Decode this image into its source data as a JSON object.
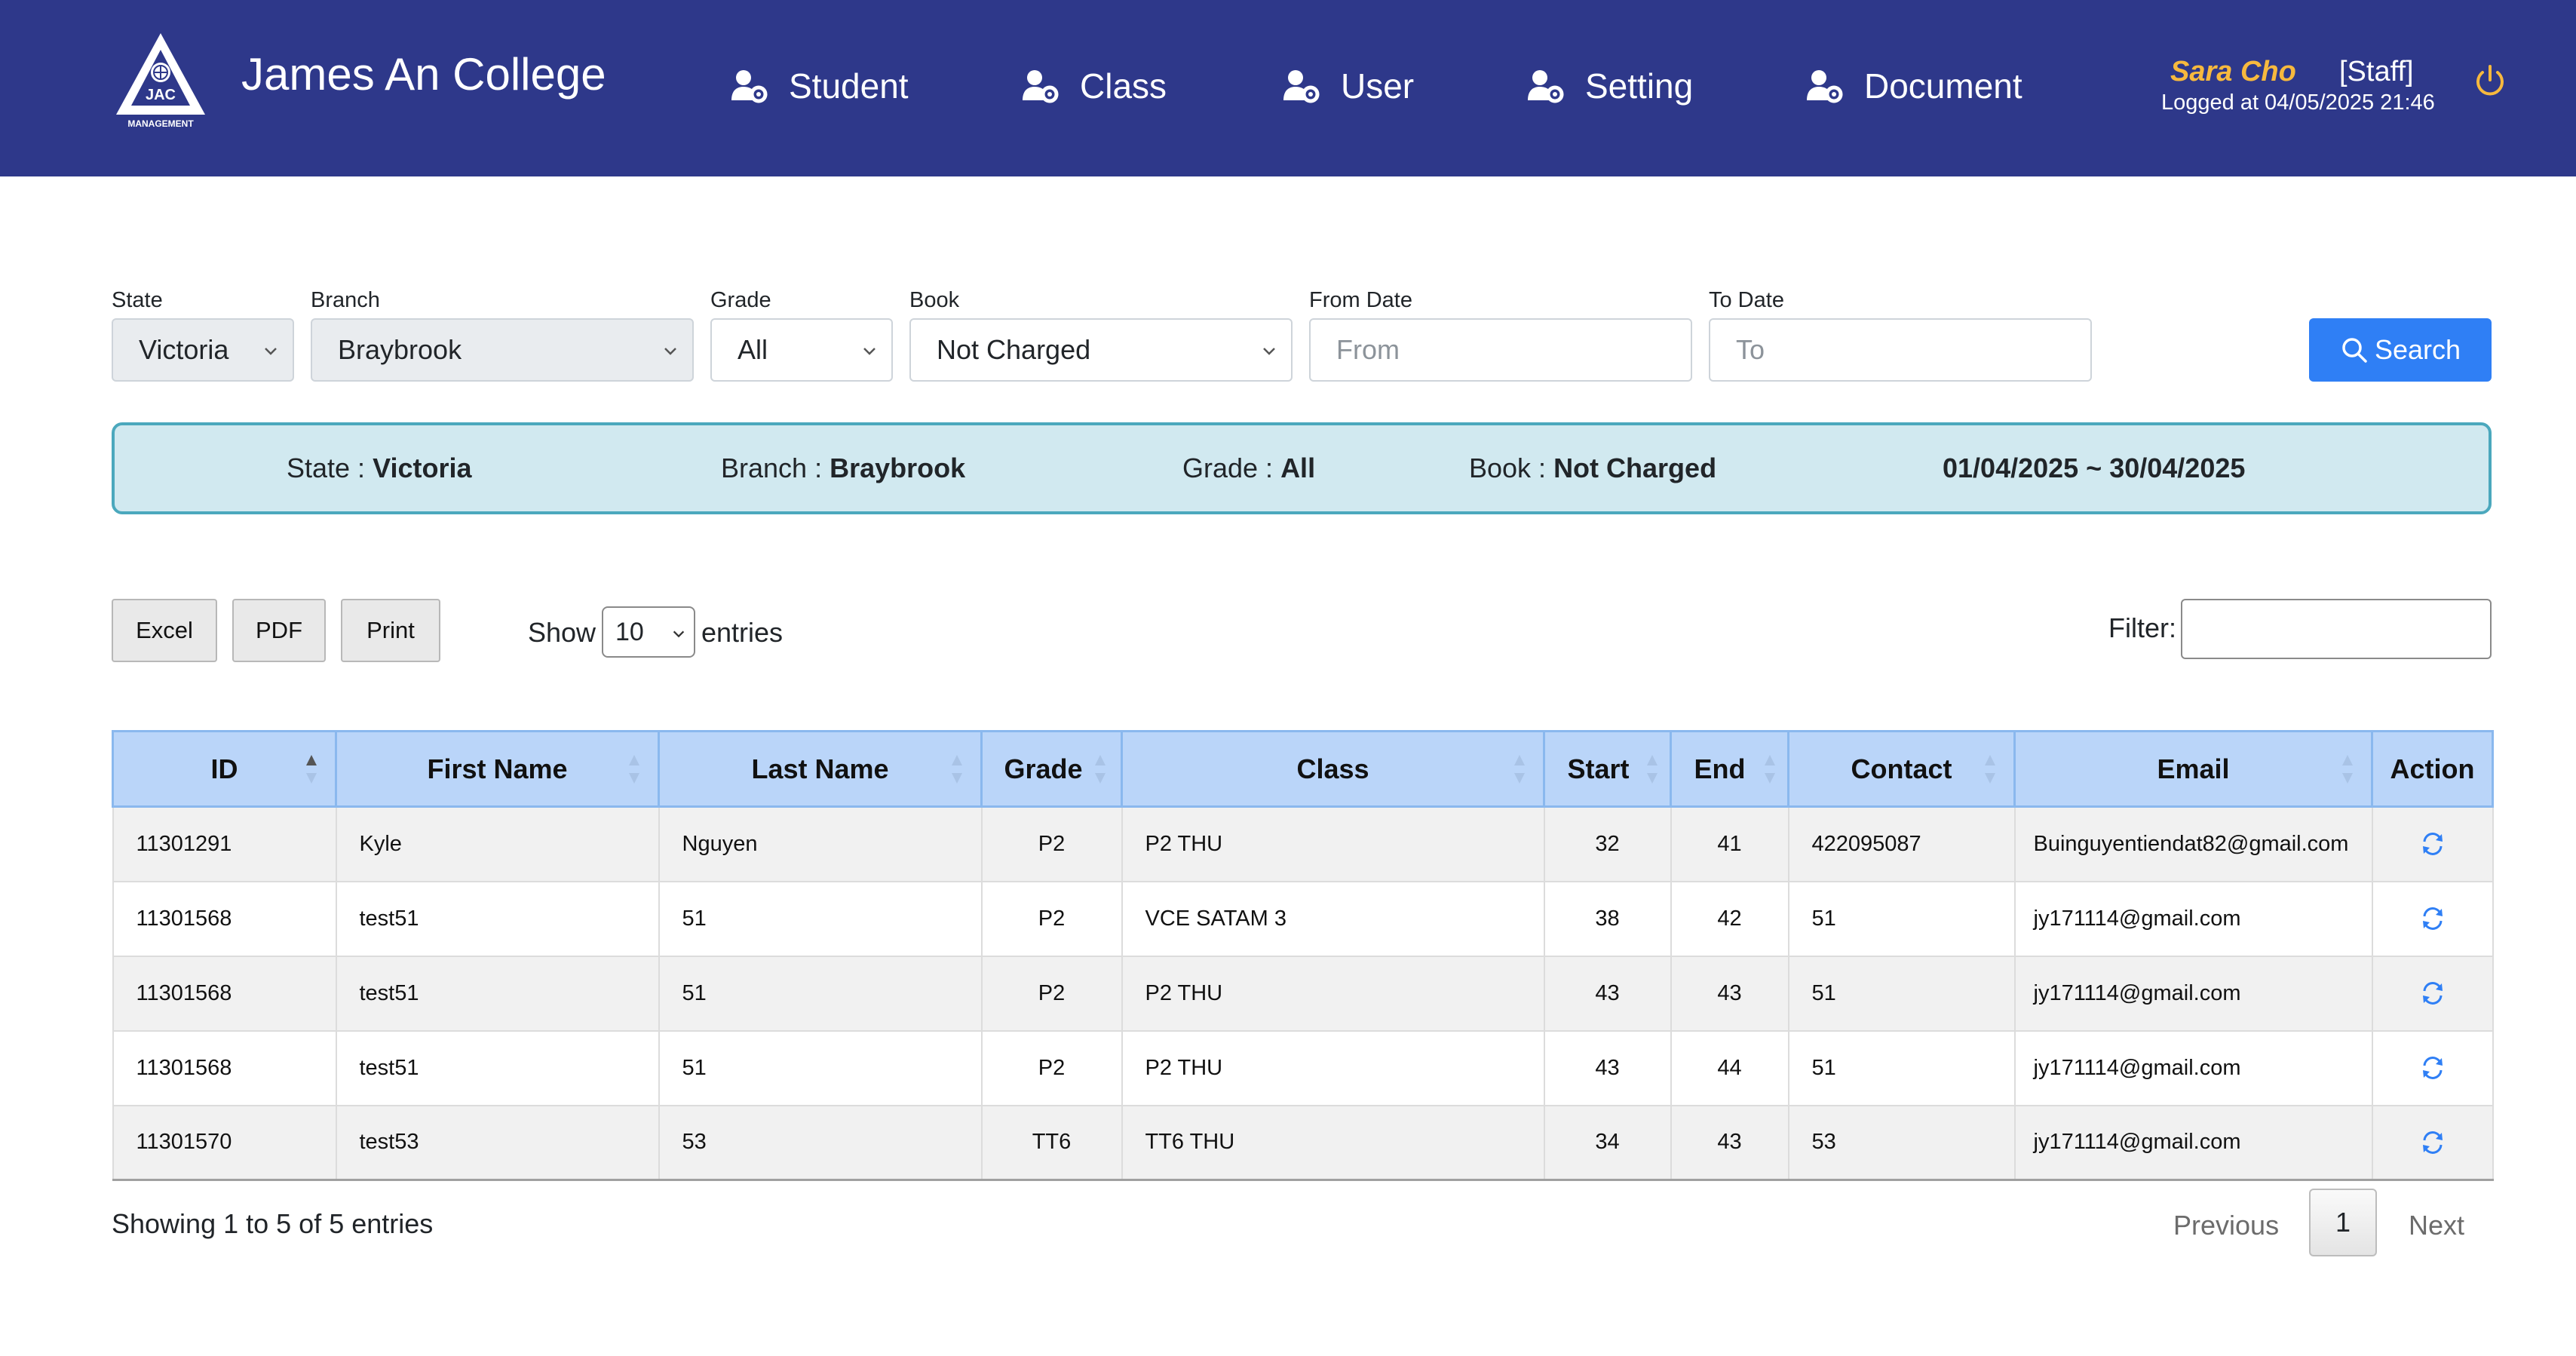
{
  "header": {
    "logo_text": "JAC",
    "logo_subtext": "MANAGEMENT",
    "brand": "James An College",
    "nav": [
      {
        "label": "Student",
        "icon": "users-cog-icon"
      },
      {
        "label": "Class",
        "icon": "users-cog-icon"
      },
      {
        "label": "User",
        "icon": "users-cog-icon"
      },
      {
        "label": "Setting",
        "icon": "users-cog-icon"
      },
      {
        "label": "Document",
        "icon": "users-cog-icon"
      }
    ],
    "user_name": "Sara Cho",
    "user_role": "[Staff]",
    "logged_label": "Logged at",
    "logged_time": "04/05/2025 21:46",
    "power_icon": "power-icon"
  },
  "filters": {
    "state": {
      "label": "State",
      "value": "Victoria"
    },
    "branch": {
      "label": "Branch",
      "value": "Braybrook"
    },
    "grade": {
      "label": "Grade",
      "value": "All"
    },
    "book": {
      "label": "Book",
      "value": "Not Charged"
    },
    "from_date": {
      "label": "From Date",
      "placeholder": "From"
    },
    "to_date": {
      "label": "To Date",
      "placeholder": "To"
    },
    "search_label": "Search"
  },
  "summary": {
    "state_label": "State : ",
    "state_value": "Victoria",
    "branch_label": "Branch : ",
    "branch_value": "Braybrook",
    "grade_label": "Grade : ",
    "grade_value": "All",
    "book_label": "Book : ",
    "book_value": "Not Charged",
    "date_range": "01/04/2025 ~ 30/04/2025"
  },
  "toolbar": {
    "excel": "Excel",
    "pdf": "PDF",
    "print": "Print",
    "show_label": "Show",
    "entries_value": "10",
    "entries_label": "entries",
    "filter_label": "Filter:"
  },
  "table": {
    "columns": [
      "ID",
      "First Name",
      "Last Name",
      "Grade",
      "Class",
      "Start",
      "End",
      "Contact",
      "Email",
      "Action"
    ],
    "rows": [
      {
        "id": "11301291",
        "first": "Kyle",
        "last": "Nguyen",
        "grade": "P2",
        "class": "P2 THU",
        "start": "32",
        "end": "41",
        "contact": "422095087",
        "email": "Buinguyentiendat82@gmail.com"
      },
      {
        "id": "11301568",
        "first": "test51",
        "last": "51",
        "grade": "P2",
        "class": "VCE SATAM 3",
        "start": "38",
        "end": "42",
        "contact": "51",
        "email": "jy171114@gmail.com"
      },
      {
        "id": "11301568",
        "first": "test51",
        "last": "51",
        "grade": "P2",
        "class": "P2 THU",
        "start": "43",
        "end": "43",
        "contact": "51",
        "email": "jy171114@gmail.com"
      },
      {
        "id": "11301568",
        "first": "test51",
        "last": "51",
        "grade": "P2",
        "class": "P2 THU",
        "start": "43",
        "end": "44",
        "contact": "51",
        "email": "jy171114@gmail.com"
      },
      {
        "id": "11301570",
        "first": "test53",
        "last": "53",
        "grade": "TT6",
        "class": "TT6 THU",
        "start": "34",
        "end": "43",
        "contact": "53",
        "email": "jy171114@gmail.com"
      }
    ]
  },
  "footer": {
    "showing": "Showing 1 to 5 of 5 entries",
    "previous": "Previous",
    "page": "1",
    "next": "Next"
  },
  "colors": {
    "header_bg": "#2e388a",
    "accent_blue": "#2f7ff5",
    "user_name": "#f7b93e",
    "summary_bg": "#d1e9f0",
    "table_header_bg": "#bad5f9"
  }
}
